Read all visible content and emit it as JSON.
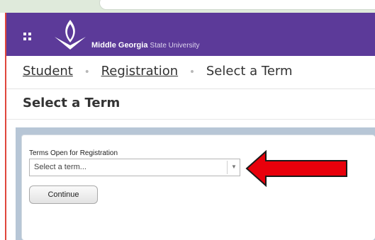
{
  "header": {
    "university_name_bold": "Middle Georgia",
    "university_name_rest": "State University",
    "brand_color": "#5c3a99"
  },
  "breadcrumb": {
    "items": [
      "Student",
      "Registration",
      "Select a Term"
    ],
    "separator": "•"
  },
  "page": {
    "title": "Select a Term"
  },
  "form": {
    "term_label": "Terms Open for Registration",
    "term_select_placeholder": "Select a term...",
    "continue_label": "Continue"
  },
  "annotation": {
    "arrow_color": "#e8000b",
    "arrow_direction": "left"
  },
  "icons": {
    "menu": "grid-menu-icon",
    "logo": "msu-knight-logo",
    "dropdown": "caret-down-icon",
    "annotation": "red-arrow-icon"
  }
}
